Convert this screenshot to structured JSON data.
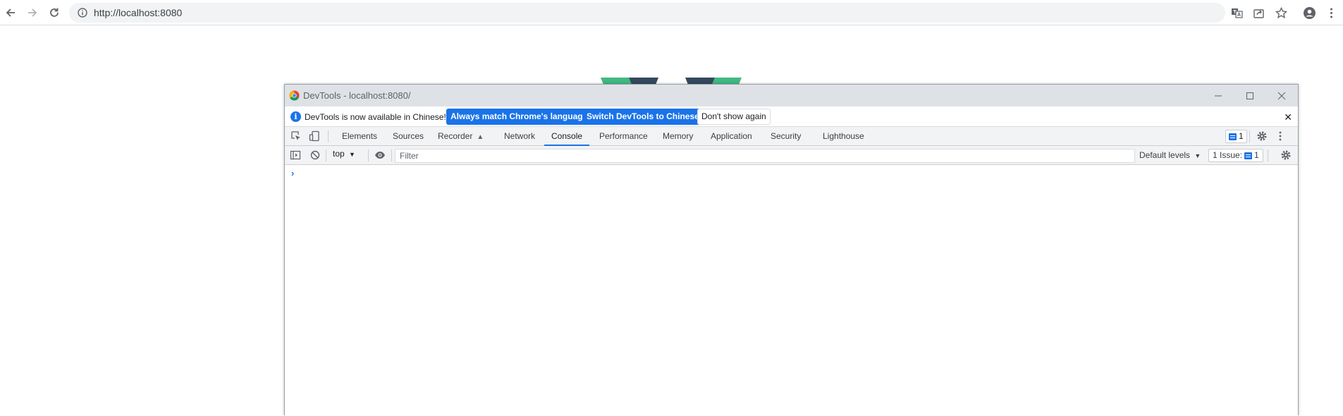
{
  "browser": {
    "url": "http://localhost:8080",
    "icons": [
      "back-icon",
      "forward-icon",
      "reload-icon",
      "site-info-icon",
      "translate-icon",
      "share-icon",
      "bookmark-star-icon",
      "profile-icon",
      "menu-icon"
    ]
  },
  "devtools": {
    "window_title": "DevTools - localhost:8080/",
    "infobar": {
      "message": "DevTools is now available in Chinese!",
      "match_language_label": "Always match Chrome's language",
      "switch_language_label": "Switch DevTools to Chinese",
      "dont_show_label": "Don't show again",
      "close_symbol": "✕"
    },
    "tabs": [
      {
        "label": "Elements"
      },
      {
        "label": "Sources"
      },
      {
        "label": "Recorder"
      },
      {
        "label": "Network"
      },
      {
        "label": "Console"
      },
      {
        "label": "Performance"
      },
      {
        "label": "Memory"
      },
      {
        "label": "Application"
      },
      {
        "label": "Security"
      },
      {
        "label": "Lighthouse"
      }
    ],
    "active_tab": "Console",
    "issues_badge_count": "1",
    "console": {
      "context": "top",
      "filter_placeholder": "Filter",
      "levels_label": "Default levels",
      "issues_label": "1 Issue:",
      "issues_count": "1",
      "prompt_symbol": "›"
    },
    "colors": {
      "accent": "#1a73e8",
      "toolbar_bg": "#f1f3f4",
      "titlebar_bg": "#dee1e6",
      "vue_green": "#41b883",
      "vue_dark": "#34495e"
    }
  }
}
